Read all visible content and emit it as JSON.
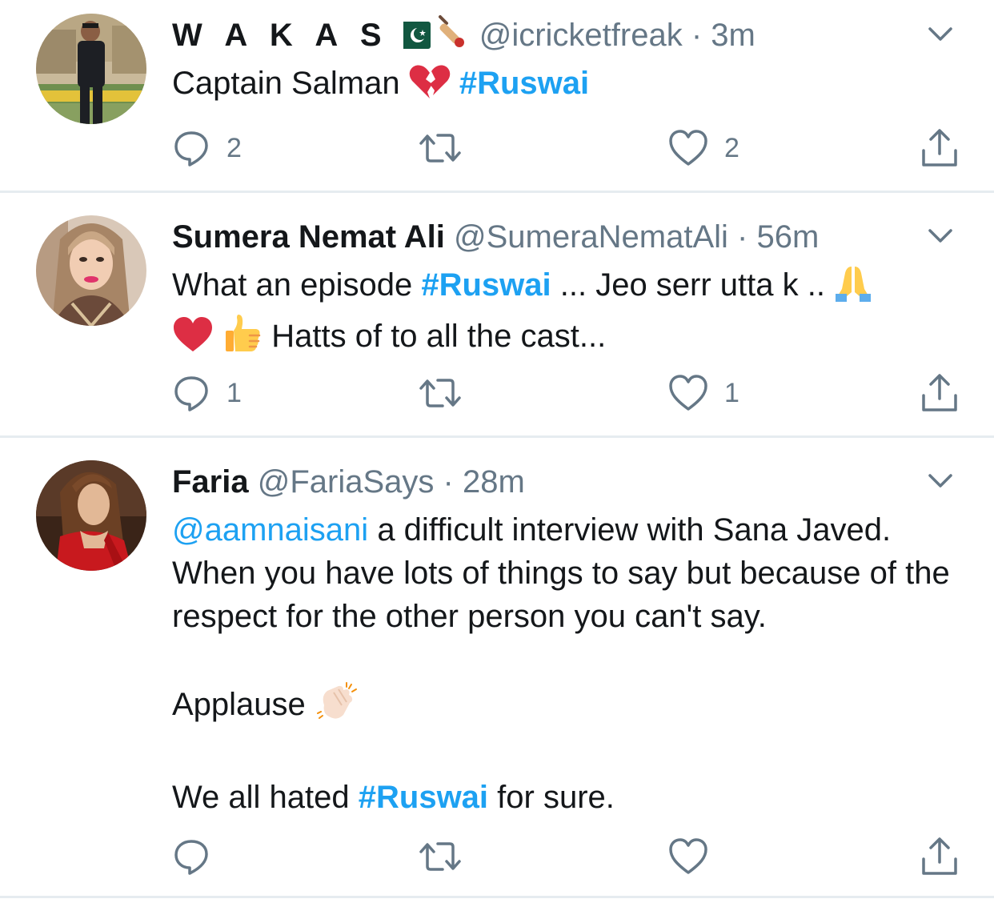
{
  "colors": {
    "link": "#1da1f2",
    "secondary_text": "#657786",
    "divider": "#e6ecf0"
  },
  "tweets": [
    {
      "display_name": "W A K A S",
      "display_emoji": [
        "pakistan-flag-emoji",
        "cricket-bat-emoji"
      ],
      "handle": "@icricketfreak",
      "separator": "·",
      "time": "3m",
      "text": {
        "t1": "Captain Salman",
        "emoji1": "broken-heart-emoji",
        "hashtag1": "#Ruswai"
      },
      "counts": {
        "reply": "2",
        "retweet": "",
        "like": "2"
      }
    },
    {
      "display_name": "Sumera Nemat Ali",
      "handle": "@SumeraNematAli",
      "separator": "·",
      "time": "56m",
      "text": {
        "t1": "What an episode",
        "hashtag1": "#Ruswai",
        "t2": "... Jeo serr utta k ..",
        "emoji1": "folded-hands-emoji",
        "emoji2": "red-heart-emoji",
        "emoji3": "thumbs-up-emoji",
        "t3": "Hatts of to all the cast..."
      },
      "counts": {
        "reply": "1",
        "retweet": "",
        "like": "1"
      }
    },
    {
      "display_name": "Faria",
      "handle": "@FariaSays",
      "separator": "·",
      "time": "28m",
      "text": {
        "mention1": "@aamnaisani",
        "t1": "a difficult interview with Sana Javed. When you have lots of things to say but because of the respect for the other person you can't say.",
        "t2": "Applause",
        "emoji1": "clapping-hands-emoji",
        "t3": "We all hated",
        "hashtag1": "#Ruswai",
        "t4": "for sure."
      },
      "counts": {
        "reply": "",
        "retweet": "",
        "like": ""
      }
    }
  ]
}
